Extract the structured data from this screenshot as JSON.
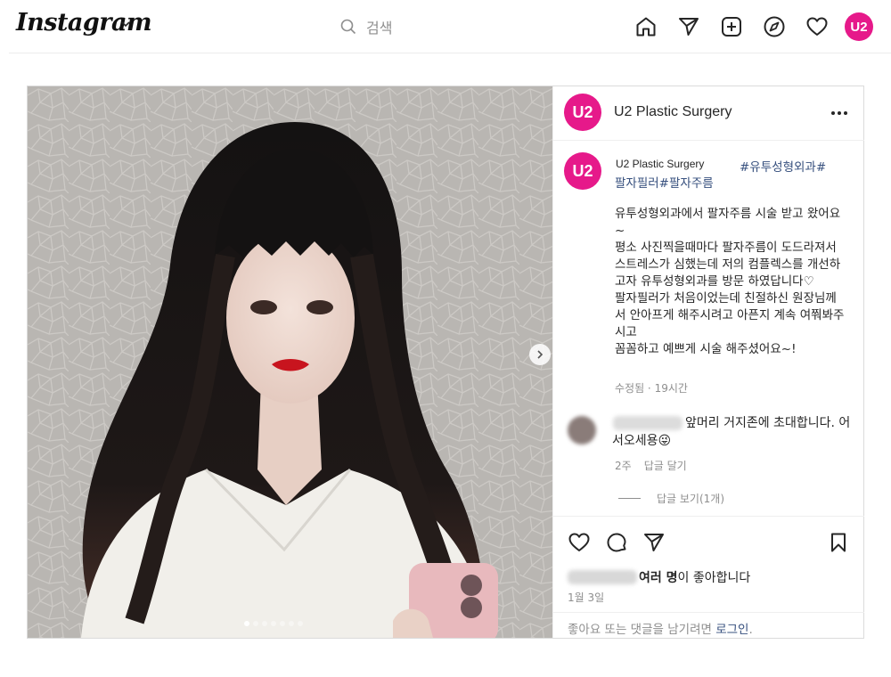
{
  "nav": {
    "logo": "Instagram",
    "search_placeholder": "검색",
    "avatar_text": "U2",
    "icons": [
      "home-icon",
      "send-icon",
      "create-icon",
      "explore-icon",
      "heart-icon"
    ]
  },
  "post": {
    "account_name": "U2 Plastic Surgery",
    "avatar_text": "U2",
    "caption_user": "U2 Plastic Surgery",
    "hashtag_line1": "#유투성형외과#",
    "hashtag_line2": "팔자필러#팔자주름",
    "caption": "유투성형외과에서 팔자주름 시술 받고 왔어요~\n평소 사진찍을때마다 팔자주름이 도드라져서 스트레스가 심했는데 저의 컴플렉스를 개선하고자 유투성형외과를 방문 하였답니다♡\n팔자필러가 처음이었는데 친절하신 원장님께서 안아프게 해주시려고 아픈지 계속 여쭤봐주시고\n꼼꼼하고 예쁘게 시술 해주셨어요~!",
    "caption_meta": "수정됨 · 19시간",
    "comment": {
      "text": "앞머리 거지존에 초대합니다. 어서오세용😜",
      "time": "2주",
      "reply_label": "답글 달기",
      "view_replies": "답글 보기(1개)"
    },
    "likes_text": "여러 명이 좋아합니다",
    "likes_bold": "여러 명",
    "date": "1월 3일",
    "login_prompt": "좋아요 또는 댓글을 남기려면 ",
    "login_link": "로그인",
    "login_suffix": ".",
    "carousel": {
      "total": 7,
      "current": 1
    }
  },
  "colors": {
    "brand": "#e6198a",
    "hashtag": "#37507e",
    "muted": "#8e8e8e"
  }
}
